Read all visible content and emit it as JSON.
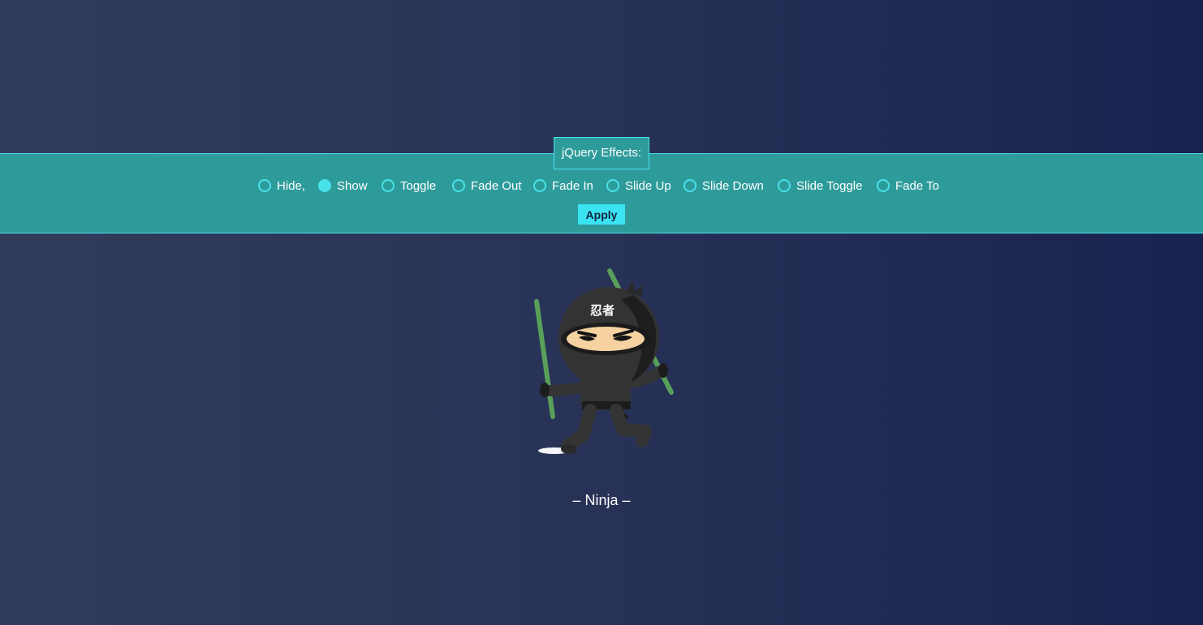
{
  "fieldset": {
    "legend": "jQuery Effects:"
  },
  "effects": [
    {
      "label": "Hide,",
      "checked": false
    },
    {
      "label": "Show",
      "checked": true
    },
    {
      "label": "Toggle",
      "checked": false
    },
    {
      "label": "Fade Out",
      "checked": false
    },
    {
      "label": "Fade In",
      "checked": false
    },
    {
      "label": "Slide Up",
      "checked": false
    },
    {
      "label": "Slide Down",
      "checked": false
    },
    {
      "label": "Slide Toggle",
      "checked": false
    },
    {
      "label": "Fade To",
      "checked": false
    }
  ],
  "apply_label": "Apply",
  "image": {
    "icon": "ninja-illustration",
    "headband_text": "忍者"
  },
  "caption": "– Ninja –",
  "colors": {
    "background_start": "#313c5a",
    "background_end": "#18224f",
    "panel": "#2e9b9b",
    "accent": "#49e1ea",
    "button": "#3be3f2"
  }
}
